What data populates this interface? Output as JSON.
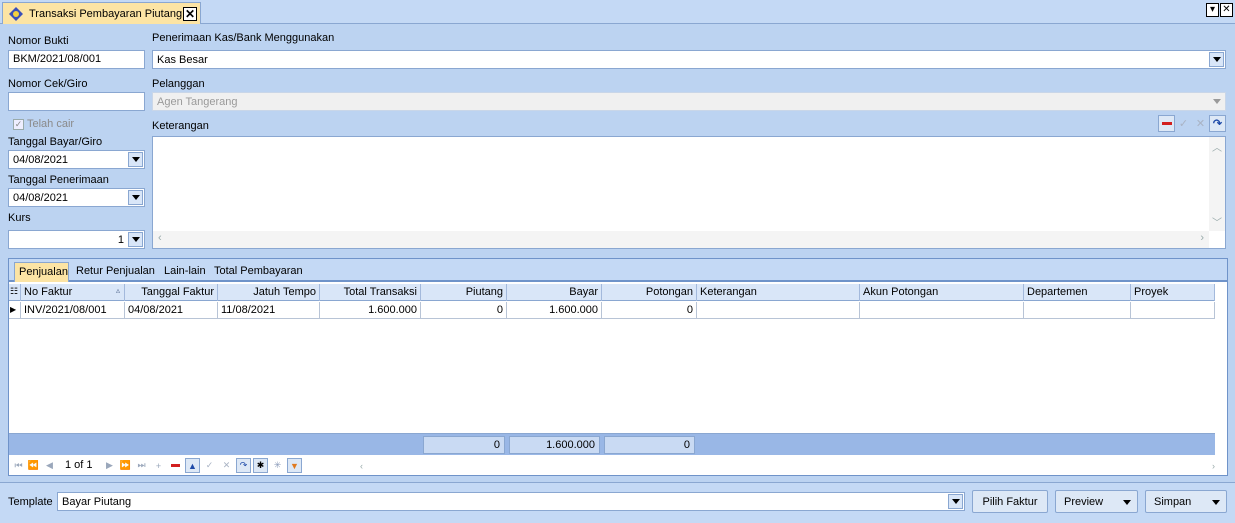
{
  "window": {
    "tab_title": "Transaksi Pembayaran Piutang",
    "close_glyph": "✕",
    "menu_glyph": "▾",
    "win_close_glyph": "✕"
  },
  "form": {
    "nomor_bukti_label": "Nomor Bukti",
    "nomor_bukti_value": "BKM/2021/08/001",
    "nomor_cek_label": "Nomor Cek/Giro",
    "nomor_cek_value": "",
    "telah_cair_label": "Telah cair",
    "telah_cair_checked": true,
    "tanggal_bayar_label": "Tanggal Bayar/Giro",
    "tanggal_bayar_value": "04/08/2021",
    "tanggal_penerimaan_label": "Tanggal Penerimaan",
    "tanggal_penerimaan_value": "04/08/2021",
    "kurs_label": "Kurs",
    "kurs_value": "1",
    "kas_bank_label": "Penerimaan Kas/Bank Menggunakan",
    "kas_bank_value": "Kas Besar",
    "pelanggan_label": "Pelanggan",
    "pelanggan_value": "Agen Tangerang",
    "keterangan_label": "Keterangan",
    "keterangan_value": ""
  },
  "grid": {
    "tabs": [
      "Penjualan",
      "Retur Penjualan",
      "Lain-lain",
      "Total Pembayaran"
    ],
    "active_tab": "Penjualan",
    "columns": [
      "No Faktur",
      "Tanggal Faktur",
      "Jatuh Tempo",
      "Total Transaksi",
      "Piutang",
      "Bayar",
      "Potongan",
      "Keterangan",
      "Akun Potongan",
      "Departemen",
      "Proyek"
    ],
    "rows": [
      {
        "no_faktur": "INV/2021/08/001",
        "tanggal_faktur": "04/08/2021",
        "jatuh_tempo": "11/08/2021",
        "total_transaksi": "1.600.000",
        "piutang": "0",
        "bayar": "1.600.000",
        "potongan": "0",
        "keterangan": "",
        "akun_potongan": "",
        "departemen": "",
        "proyek": ""
      }
    ],
    "footer": {
      "piutang_total": "0",
      "bayar_total": "1.600.000",
      "potongan_total": "0"
    },
    "navigator": {
      "record_text": "1 of 1"
    }
  },
  "bottom": {
    "template_label": "Template",
    "template_value": "Bayar Piutang",
    "pilih_faktur_label": "Pilih Faktur",
    "preview_label": "Preview",
    "simpan_label": "Simpan"
  },
  "colors": {
    "background": "#bcd3f1",
    "active_tab": "#fce4a4",
    "border": "#8aa7d1",
    "delete_red": "#d21f1f",
    "filter_orange": "#e07a1f"
  }
}
